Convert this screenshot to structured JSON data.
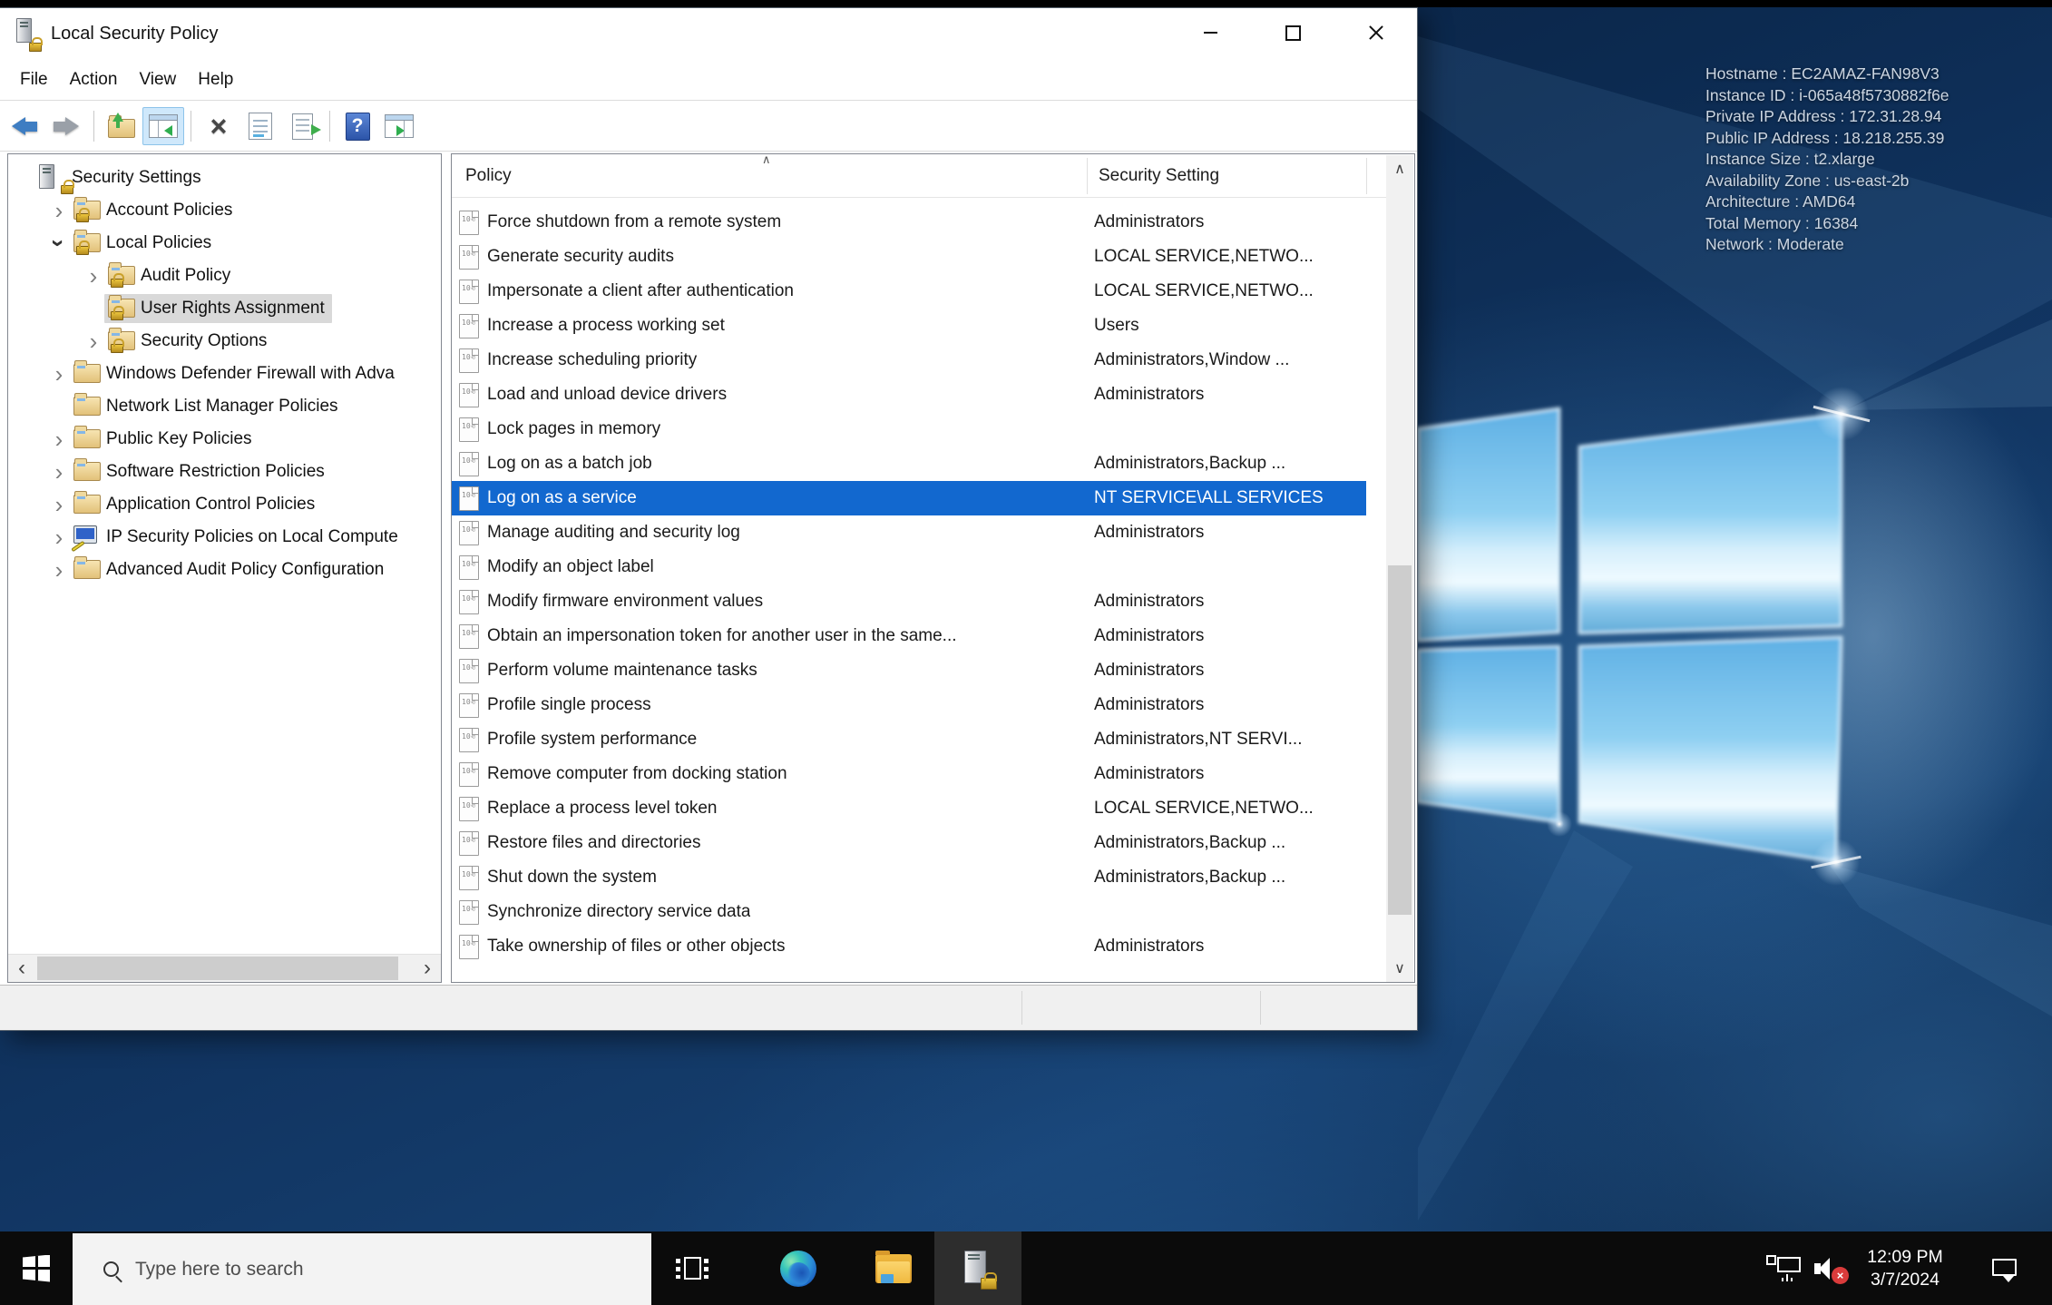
{
  "desktop": {
    "instance_info": [
      "Hostname : EC2AMAZ-FAN98V3",
      "Instance ID : i-065a48f5730882f6e",
      "Private IP Address : 172.31.28.94",
      "Public IP Address : 18.218.255.39",
      "Instance Size : t2.xlarge",
      "Availability Zone : us-east-2b",
      "Architecture : AMD64",
      "Total Memory : 16384",
      "Network : Moderate"
    ],
    "wallpaper_accent": "#4da7dd"
  },
  "window": {
    "title": "Local Security Policy",
    "menu": {
      "items": [
        "File",
        "Action",
        "View",
        "Help"
      ]
    },
    "toolbar": {
      "buttons": [
        "back",
        "forward",
        "export",
        "show-console-tree",
        "delete",
        "properties",
        "export-list",
        "help",
        "show-action-pane"
      ],
      "active_button": "show-console-tree"
    },
    "tree": {
      "items": [
        {
          "label": "Security Settings",
          "level": 0,
          "exp": "none",
          "icon": "root",
          "selected": false
        },
        {
          "label": "Account Policies",
          "level": 1,
          "exp": "collapsed",
          "icon": "folder-lock",
          "selected": false
        },
        {
          "label": "Local Policies",
          "level": 1,
          "exp": "expanded",
          "icon": "folder-lock",
          "selected": false
        },
        {
          "label": "Audit Policy",
          "level": 2,
          "exp": "collapsed",
          "icon": "folder-lock",
          "selected": false
        },
        {
          "label": "User Rights Assignment",
          "level": 2,
          "exp": "none",
          "icon": "folder-lock",
          "selected": true
        },
        {
          "label": "Security Options",
          "level": 2,
          "exp": "collapsed",
          "icon": "folder-lock",
          "selected": false
        },
        {
          "label": "Windows Defender Firewall with Adva",
          "level": 1,
          "exp": "collapsed",
          "icon": "folder",
          "selected": false
        },
        {
          "label": "Network List Manager Policies",
          "level": 1,
          "exp": "none",
          "icon": "folder",
          "selected": false
        },
        {
          "label": "Public Key Policies",
          "level": 1,
          "exp": "collapsed",
          "icon": "folder",
          "selected": false
        },
        {
          "label": "Software Restriction Policies",
          "level": 1,
          "exp": "collapsed",
          "icon": "folder",
          "selected": false
        },
        {
          "label": "Application Control Policies",
          "level": 1,
          "exp": "collapsed",
          "icon": "folder",
          "selected": false
        },
        {
          "label": "IP Security Policies on Local Compute",
          "level": 1,
          "exp": "collapsed",
          "icon": "ipsec",
          "selected": false
        },
        {
          "label": "Advanced Audit Policy Configuration",
          "level": 1,
          "exp": "collapsed",
          "icon": "folder",
          "selected": false
        }
      ]
    },
    "list": {
      "columns": [
        "Policy",
        "Security Setting"
      ],
      "selected_index": 8,
      "selection_color": "#1268cf",
      "rows": [
        {
          "policy": "Force shutdown from a remote system",
          "setting": "Administrators"
        },
        {
          "policy": "Generate security audits",
          "setting": "LOCAL SERVICE,NETWO..."
        },
        {
          "policy": "Impersonate a client after authentication",
          "setting": "LOCAL SERVICE,NETWO..."
        },
        {
          "policy": "Increase a process working set",
          "setting": "Users"
        },
        {
          "policy": "Increase scheduling priority",
          "setting": "Administrators,Window ..."
        },
        {
          "policy": "Load and unload device drivers",
          "setting": "Administrators"
        },
        {
          "policy": "Lock pages in memory",
          "setting": ""
        },
        {
          "policy": "Log on as a batch job",
          "setting": "Administrators,Backup ..."
        },
        {
          "policy": "Log on as a service",
          "setting": "NT SERVICE\\ALL SERVICES"
        },
        {
          "policy": "Manage auditing and security log",
          "setting": "Administrators"
        },
        {
          "policy": "Modify an object label",
          "setting": ""
        },
        {
          "policy": "Modify firmware environment values",
          "setting": "Administrators"
        },
        {
          "policy": "Obtain an impersonation token for another user in the same...",
          "setting": "Administrators"
        },
        {
          "policy": "Perform volume maintenance tasks",
          "setting": "Administrators"
        },
        {
          "policy": "Profile single process",
          "setting": "Administrators"
        },
        {
          "policy": "Profile system performance",
          "setting": "Administrators,NT SERVI..."
        },
        {
          "policy": "Remove computer from docking station",
          "setting": "Administrators"
        },
        {
          "policy": "Replace a process level token",
          "setting": "LOCAL SERVICE,NETWO..."
        },
        {
          "policy": "Restore files and directories",
          "setting": "Administrators,Backup ..."
        },
        {
          "policy": "Shut down the system",
          "setting": "Administrators,Backup ..."
        },
        {
          "policy": "Synchronize directory service data",
          "setting": ""
        },
        {
          "policy": "Take ownership of files or other objects",
          "setting": "Administrators"
        }
      ]
    }
  },
  "taskbar": {
    "search_placeholder": "Type here to search",
    "pinned_icons": [
      "task-view",
      "edge",
      "file-explorer",
      "local-security-policy"
    ],
    "tray_icons": [
      "network",
      "volume-muted",
      "action-center"
    ],
    "clock": {
      "time": "12:09 PM",
      "date": "3/7/2024"
    }
  }
}
